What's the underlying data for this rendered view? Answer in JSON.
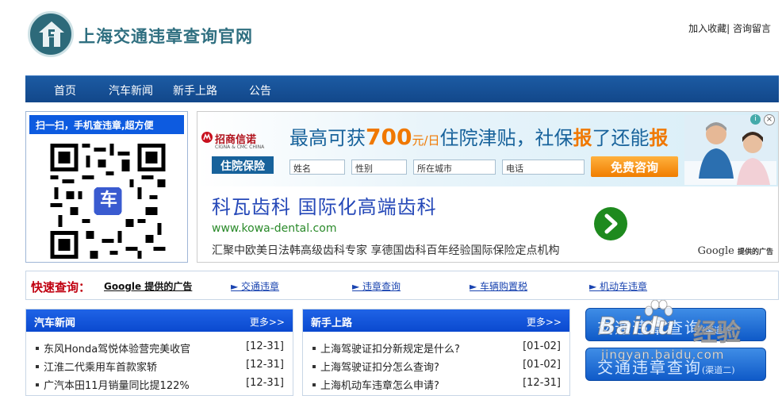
{
  "site": {
    "name": "上海交通违章查询官网"
  },
  "toplinks": {
    "fav": "加入收藏",
    "sep": "|",
    "msg": "咨询留言"
  },
  "nav": [
    "首页",
    "汽车新闻",
    "新手上路",
    "公告"
  ],
  "qr": {
    "title": "扫一扫，手机查违章,超方便",
    "center": "车"
  },
  "ad": {
    "brand": "招商信诺",
    "brand_sub": "CIGNA & CMC CHINA",
    "ins_label": "住院保险",
    "headline_pre": "最高可获",
    "headline_num": "700",
    "headline_unit": "元/日",
    "headline_mid": "住院津贴，社保",
    "headline_bao1": "报",
    "headline_mid2": "了还能",
    "headline_bao2": "报",
    "fields": [
      "姓名",
      "性别",
      "所在城市",
      "电话"
    ],
    "button": "免费咨询",
    "title": "科瓦齿科 国际化高端齿科",
    "url": "www.kowa-dental.com",
    "desc": "汇聚中欧美日法韩高级齿科专家 享德国齿科百年经验国际保险定点机构",
    "google": "Google",
    "google_sub": "提供的广告"
  },
  "quick": {
    "label": "快速查询：",
    "google_ad": "Google 提供的广告",
    "links": [
      "► 交通违章",
      "► 违章查询",
      "► 车辆购置税",
      "► 机动车违章"
    ]
  },
  "news": {
    "title": "汽车新闻",
    "more": "更多>>",
    "items": [
      {
        "text": "东风Honda驾悦体验营完美收官",
        "date": "[12-31]"
      },
      {
        "text": "江淮二代乘用车首款家轿",
        "date": "[12-31]"
      },
      {
        "text": "广汽本田11月销量同比提122%",
        "date": "[12-31]"
      }
    ]
  },
  "newbie": {
    "title": "新手上路",
    "more": "更多>>",
    "items": [
      {
        "text": "上海驾驶证扣分新规定是什么?",
        "date": "[01-02]"
      },
      {
        "text": "上海驾驶证扣分怎么查询?",
        "date": "[01-02]"
      },
      {
        "text": "上海机动车违章怎么申请?",
        "date": "[12-31]"
      }
    ]
  },
  "side_buttons": [
    {
      "label": "交通违章查询",
      "sub": "(渠道一)"
    },
    {
      "label": "交通违章查询",
      "sub": "(渠道二)"
    }
  ],
  "watermark": {
    "brand": "Baidu",
    "cn": "经验",
    "url": "jingyan.baidu.com"
  }
}
